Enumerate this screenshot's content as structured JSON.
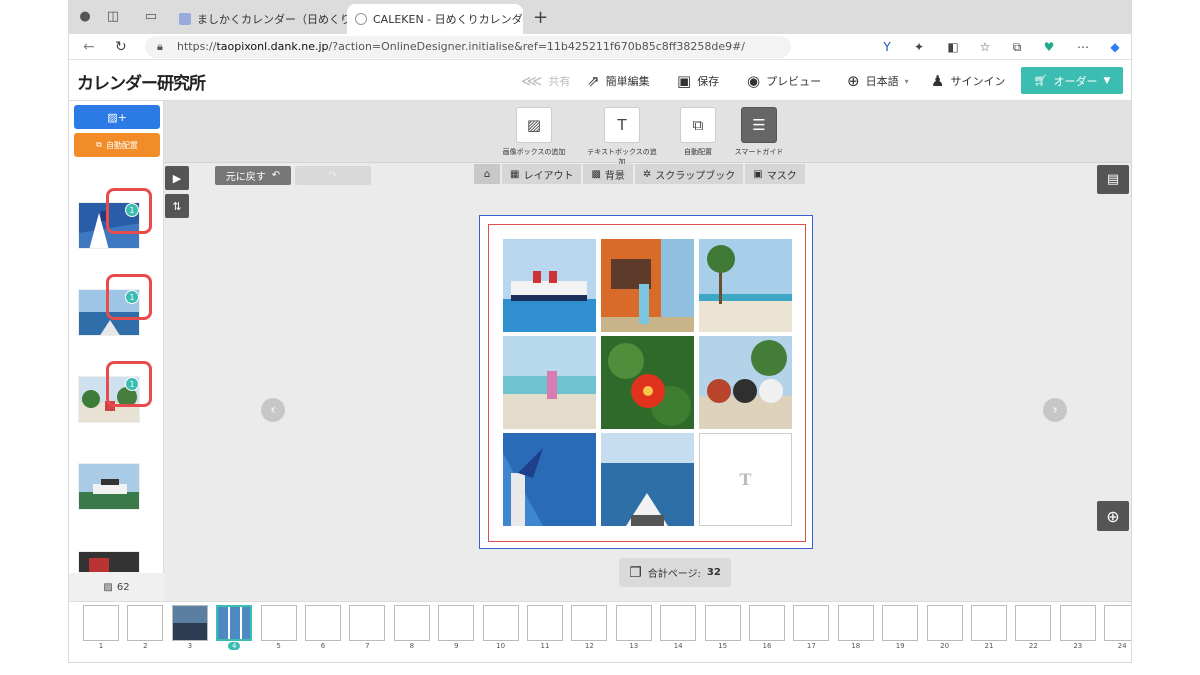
{
  "browser": {
    "tabs": [
      {
        "title": "ましかくカレンダー（日めくり） -",
        "active": false
      },
      {
        "title": "CALEKEN - 日めくりカレンダー#",
        "active": true
      }
    ],
    "url_prefix": "https://",
    "url_host": "taopixonl.dank.ne.jp",
    "url_rest": "/?action=OnlineDesigner.initialise&ref=11b425211f670b85c8ff38258de9#/"
  },
  "header": {
    "logo": "カレンダー研究所",
    "share": "共有",
    "easy_edit": "簡単編集",
    "save": "保存",
    "preview": "プレビュー",
    "language": "日本語",
    "signin": "サインイン",
    "order": "オーダー"
  },
  "toolbar": {
    "add_image": "画像ボックスの追加",
    "add_text": "テキストボックスの追加",
    "auto_layout": "自動配置",
    "smart_guide": "スマートガイド"
  },
  "left": {
    "auto_button": "自動配置",
    "image_count": "62",
    "badges": [
      "1",
      "1",
      "1"
    ]
  },
  "workspace": {
    "undo": "元に戻す",
    "tabs": [
      "レイアウト",
      "背景",
      "スクラップブック",
      "マスク"
    ],
    "text_placeholder": "T",
    "total_pages_label": "合計ページ:",
    "total_pages": "32"
  },
  "filmstrip": [
    "1",
    "2",
    "3",
    "4",
    "5",
    "6",
    "7",
    "8",
    "9",
    "10",
    "11",
    "12",
    "13",
    "14",
    "15",
    "16",
    "17",
    "18",
    "19",
    "20",
    "21",
    "22",
    "23",
    "24"
  ],
  "colors": {
    "accent": "#3cbdb1",
    "primary": "#2c7be5",
    "orange": "#f28c28",
    "highlight": "#e74c4c"
  }
}
